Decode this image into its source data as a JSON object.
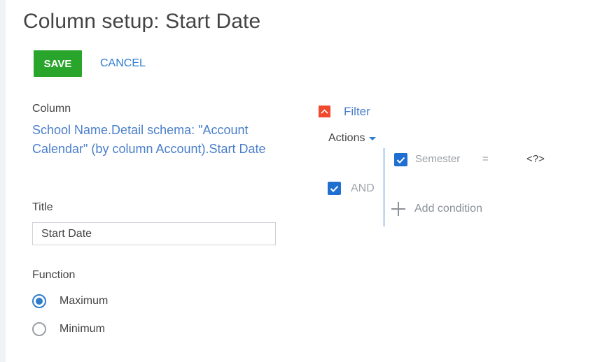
{
  "page": {
    "title": "Column setup: Start Date"
  },
  "toolbar": {
    "save_label": "SAVE",
    "cancel_label": "CANCEL"
  },
  "form": {
    "column_label": "Column",
    "column_value": "School Name.Detail schema: \"Account Calendar\" (by column Account).Start Date",
    "title_label": "Title",
    "title_value": "Start Date",
    "function_label": "Function",
    "function_options": [
      {
        "label": "Maximum",
        "selected": true
      },
      {
        "label": "Minimum",
        "selected": false
      }
    ]
  },
  "filter": {
    "label": "Filter",
    "collapse_icon": "chevron-up-icon",
    "actions_label": "Actions",
    "group_operator": "AND",
    "group_checked": true,
    "conditions": [
      {
        "checked": true,
        "column": "Semester",
        "operator": "=",
        "value": "<?>"
      }
    ],
    "add_condition_label": "Add condition"
  },
  "colors": {
    "save_green": "#2aa52c",
    "link_blue": "#2e7dcd",
    "collapse_red": "#f0492e",
    "checkbox_blue": "#1f6fd1"
  }
}
